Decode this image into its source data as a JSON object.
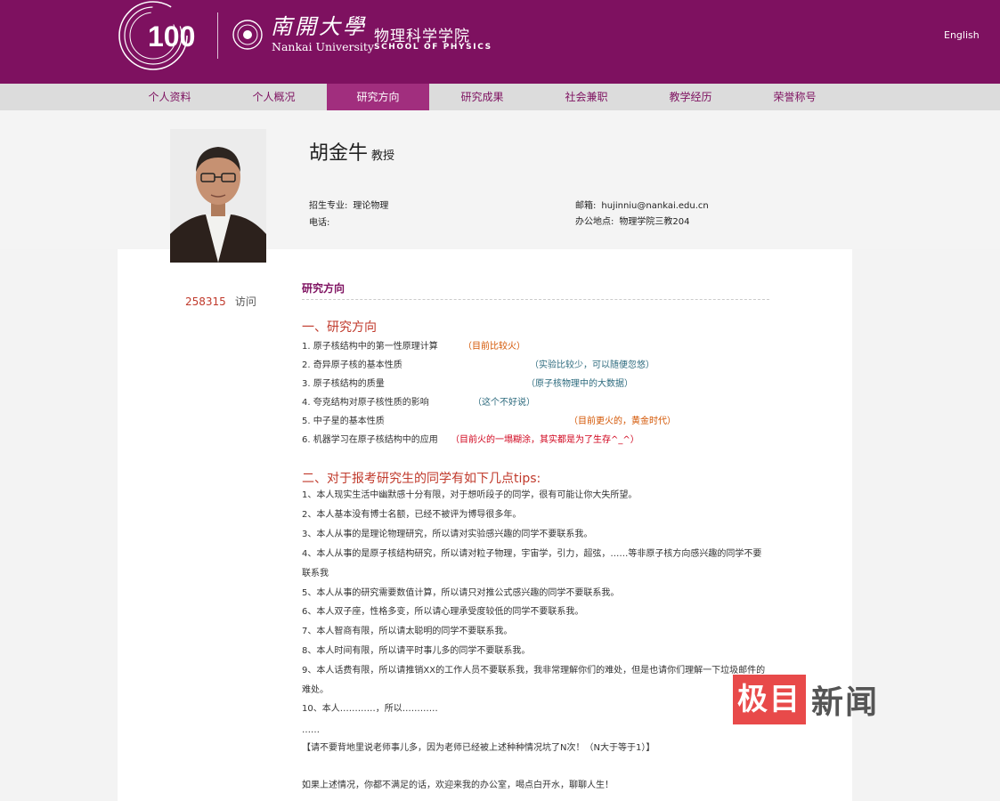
{
  "header": {
    "logo_100": "100",
    "university_cn": "南開大學",
    "university_en": "Nankai University",
    "school_cn": "物理科学学院",
    "school_en": "SCHOOL OF PHYSICS",
    "language_link": "English",
    "brand_color": "#7e1160"
  },
  "nav": {
    "items": [
      "个人资料",
      "个人概况",
      "研究方向",
      "研究成果",
      "社会兼职",
      "教学经历",
      "荣誉称号"
    ],
    "active": "研究方向"
  },
  "profile": {
    "name": "胡金牛",
    "title": "教授",
    "major_label": "招生专业:",
    "major_value": "理论物理",
    "phone_label": "电话:",
    "phone_value": "",
    "email_label": "邮箱:",
    "email_value": "hujinniu@nankai.edu.cn",
    "office_label": "办公地点:",
    "office_value": "物理学院三教204"
  },
  "visits": {
    "count": "258315",
    "label": "访问"
  },
  "section": {
    "title": "研究方向",
    "heading1": "一、研究方向",
    "directions": [
      {
        "text": "1. 原子核结构中的第一性原理计算",
        "note": "（目前比较火）"
      },
      {
        "text": "2. 奇异原子核的基本性质",
        "note": "（实验比较少，可以随便忽悠）"
      },
      {
        "text": "3. 原子核结构的质量",
        "note": "（原子核物理中的大数据）"
      },
      {
        "text": "4. 夸克结构对原子核性质的影响",
        "note": "（这个不好说）"
      },
      {
        "text": "5. 中子星的基本性质",
        "note": "（目前更火的，黄金时代）"
      },
      {
        "text": "6. 机器学习在原子核结构中的应用",
        "note": "（目前火的一塌糊涂，其实都是为了生存^_^）"
      }
    ],
    "heading2": "二、对于报考研究生的同学有如下几点tips:",
    "tips": [
      "1、本人现实生活中幽默感十分有限，对于想听段子的同学，很有可能让你大失所望。",
      "2、本人基本没有博士名额，已经不被评为博导很多年。",
      "3、本人从事的是理论物理研究，所以请对实验感兴趣的同学不要联系我。",
      "4、本人从事的是原子核结构研究，所以请对粒子物理，宇宙学，引力，超弦，……等非原子核方向感兴趣的同学不要联系我",
      "5、本人从事的研究需要数值计算，所以请只对推公式感兴趣的同学不要联系我。",
      "6、本人双子座，性格多变，所以请心理承受度较低的同学不要联系我。",
      "7、本人智商有限，所以请太聪明的同学不要联系我。",
      "8、本人时间有限，所以请平时事儿多的同学不要联系我。",
      "9、本人话费有限，所以请推销XX的工作人员不要联系我，我非常理解你们的难处，但是也请你们理解一下垃圾邮件的难处。",
      "10、本人…………，所以…………",
      "……",
      "【请不要背地里说老师事儿多，因为老师已经被上述种种情况坑了N次！（N大于等于1）】",
      "",
      "如果上述情况，你都不满足的话，欢迎来我的办公室，喝点白开水，聊聊人生！"
    ]
  },
  "watermark": {
    "box": "极目",
    "text": "新闻",
    "box_color": "#e84a4a"
  }
}
